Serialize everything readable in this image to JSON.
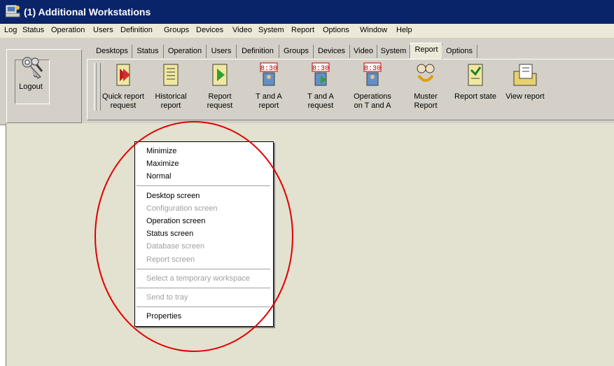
{
  "window": {
    "title": "(1) Additional Workstations"
  },
  "menubar": {
    "items": [
      "Log",
      "Status",
      "Operation",
      "Users",
      "Definition",
      "Groups",
      "Devices",
      "Video",
      "System",
      "Report",
      "Options",
      "Window",
      "Help"
    ]
  },
  "logout": {
    "label": "Logout",
    "icon": "keys-icon"
  },
  "tabs": {
    "items": [
      "Desktops",
      "Status",
      "Operation",
      "Users",
      "Definition",
      "Groups",
      "Devices",
      "Video",
      "System",
      "Report",
      "Options"
    ],
    "active": "Report"
  },
  "toolbar": {
    "buttons": [
      {
        "label": "Quick report\nrequest",
        "icon": "quick-report-icon"
      },
      {
        "label": "Historical\nreport",
        "icon": "historical-report-icon"
      },
      {
        "label": "Report\nrequest",
        "icon": "report-request-icon"
      },
      {
        "label": "T and A\nreport",
        "icon": "t-and-a-report-icon"
      },
      {
        "label": "T and A\nrequest",
        "icon": "t-and-a-request-icon"
      },
      {
        "label": "Operations\non T and A",
        "icon": "operations-t-and-a-icon"
      },
      {
        "label": "Muster\nReport",
        "icon": "muster-report-icon"
      },
      {
        "label": "Report state",
        "icon": "report-state-icon"
      },
      {
        "label": "View report",
        "icon": "view-report-icon"
      }
    ]
  },
  "context_menu": {
    "groups": [
      [
        {
          "label": "Minimize",
          "enabled": true
        },
        {
          "label": "Maximize",
          "enabled": true
        },
        {
          "label": "Normal",
          "enabled": true
        }
      ],
      [
        {
          "label": "Desktop screen",
          "enabled": true
        },
        {
          "label": "Configuration screen",
          "enabled": false
        },
        {
          "label": "Operation screen",
          "enabled": true
        },
        {
          "label": "Status screen",
          "enabled": true
        },
        {
          "label": "Database screen",
          "enabled": false
        },
        {
          "label": "Report screen",
          "enabled": false
        }
      ],
      [
        {
          "label": "Select a temporary workspace",
          "enabled": false
        }
      ],
      [
        {
          "label": "Send to tray",
          "enabled": false
        }
      ],
      [
        {
          "label": "Properties",
          "enabled": true
        }
      ]
    ]
  },
  "colors": {
    "titlebar": "#0a246a",
    "workspace": "#e3e1cf",
    "highlight_ring": "#e00000",
    "disabled_text": "#a0a0a0"
  }
}
